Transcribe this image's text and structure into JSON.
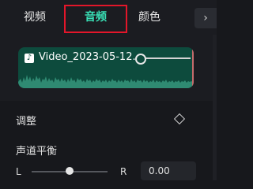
{
  "tabs": [
    {
      "label": "视频"
    },
    {
      "label": "音频",
      "active": true
    },
    {
      "label": "颜色"
    }
  ],
  "tab_more_glyph": "›",
  "clip": {
    "icon": "music-note-icon",
    "name": "Video_2023-05-12..."
  },
  "adjust": {
    "label": "调整",
    "icon": "keyframe-diamond-icon"
  },
  "balance": {
    "title": "声道平衡",
    "left_label": "L",
    "right_label": "R",
    "value": "0.00",
    "position_fraction": 0.5
  },
  "colors": {
    "accent": "#39e0b6",
    "highlight_box": "#e3162a",
    "clip_bg": "#0d4b3d"
  }
}
